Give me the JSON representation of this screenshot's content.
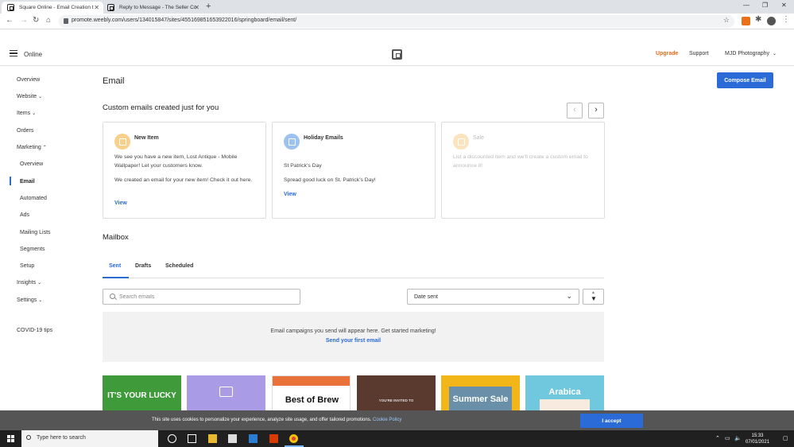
{
  "browser": {
    "tabs": [
      {
        "title": "Square Online - Email Creation t"
      },
      {
        "title": "Reply to Message - The Seller Co"
      }
    ],
    "url": "promote.weebly.com/users/134015847/sites/455169851653922016/springboard/email/sent/"
  },
  "header": {
    "app_name": "Online",
    "upgrade": "Upgrade",
    "support": "Support",
    "account": "MJD Photography"
  },
  "sidebar": {
    "overview": "Overview",
    "website": "Website",
    "items": "Items",
    "orders": "Orders",
    "marketing": "Marketing",
    "marketing_sub": {
      "overview": "Overview",
      "email": "Email",
      "automated": "Automated",
      "ads": "Ads",
      "mailing_lists": "Mailing Lists",
      "segments": "Segments",
      "setup": "Setup"
    },
    "insights": "Insights",
    "settings": "Settings",
    "covid": "COVID-19 tips"
  },
  "main": {
    "title": "Email",
    "compose_label": "Compose Email",
    "custom_title": "Custom emails created just for you",
    "cards": [
      {
        "title": "New Item",
        "text1": "We see you have a new item, Lost Antique - Mobile Wallpaper! Let your customers know.",
        "text2": "We created an email for your new item! Check it out here.",
        "link": "View",
        "icon_color": "#f9cf8c"
      },
      {
        "title": "Holiday Emails",
        "text1": "St Patrick's Day",
        "text2": "Spread good luck on St. Patrick's Day!",
        "link": "View",
        "icon_color": "#9cc2f0"
      },
      {
        "title": "Sale",
        "text1": "List a discounted item and we'll create a custom email to announce it!",
        "icon_color": "#fbe3bd"
      }
    ],
    "mailbox_title": "Mailbox",
    "tabs": {
      "sent": "Sent",
      "drafts": "Drafts",
      "scheduled": "Scheduled"
    },
    "search_placeholder": "Search emails",
    "sort_value": "Date sent",
    "empty_text": "Email campaigns you send will appear here. Get started marketing!",
    "empty_link": "Send your first email",
    "templates": [
      {
        "text": "IT'S YOUR LUCKY",
        "bg": "#3f9a3a"
      },
      {
        "text": "",
        "bg": "#a99be6"
      },
      {
        "text": "Best of Brew",
        "bg": "#ffffff"
      },
      {
        "text": "YOU'RE INVITED TO",
        "bg": "#5a3a2e"
      },
      {
        "text": "Summer Sale",
        "bg": "#f2b619"
      },
      {
        "text": "Arabica",
        "bg": "#6fc8de"
      }
    ]
  },
  "cookie": {
    "text": "This site uses cookies to personalize your experience, analyze site usage, and offer tailored promotions.",
    "link": "Cookie Policy",
    "accept": "I accept"
  },
  "taskbar": {
    "search_placeholder": "Type here to search",
    "time": "15:33",
    "date": "07/01/2021"
  },
  "colors": {
    "accent": "#2a6bd8",
    "upgrade": "#e86b1c"
  }
}
